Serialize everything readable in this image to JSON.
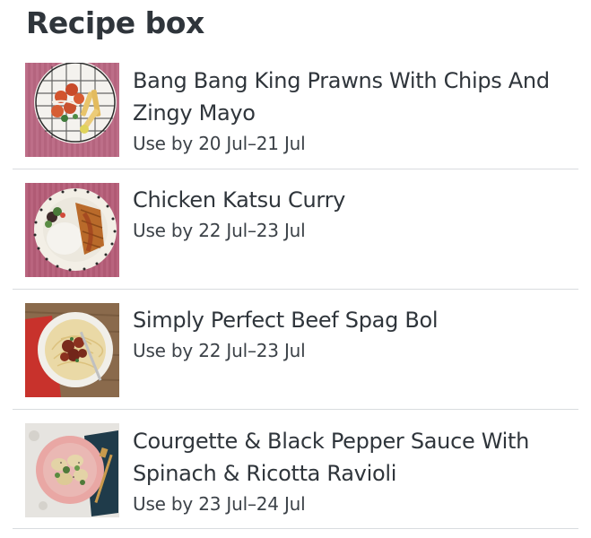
{
  "header": {
    "title": "Recipe box"
  },
  "recipes": [
    {
      "name": "Bang Bang King Prawns With Chips And Zingy Mayo",
      "use_by": "Use by 20 Jul–21 Jul",
      "image": "prawns-dish-image"
    },
    {
      "name": "Chicken Katsu Curry",
      "use_by": "Use by 22 Jul–23 Jul",
      "image": "katsu-curry-image"
    },
    {
      "name": "Simply Perfect Beef Spag Bol",
      "use_by": "Use by 22 Jul–23 Jul",
      "image": "spag-bol-image"
    },
    {
      "name": "Courgette & Black Pepper Sauce With Spinach & Ricotta Ravioli",
      "use_by": "Use by 23 Jul–24 Jul",
      "image": "ravioli-image"
    }
  ],
  "colors": {
    "text": "#2f353b",
    "divider": "#d9dcdf",
    "background": "#ffffff"
  }
}
